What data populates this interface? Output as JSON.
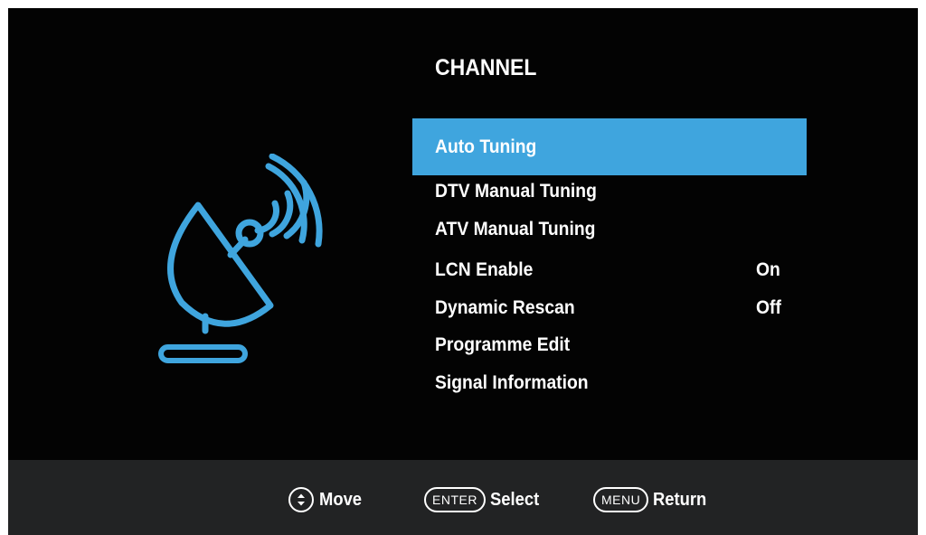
{
  "menu": {
    "title": "CHANNEL",
    "items": [
      {
        "label": "Auto Tuning",
        "value": "",
        "selected": true
      },
      {
        "label": "DTV Manual Tuning",
        "value": ""
      },
      {
        "label": "ATV Manual Tuning",
        "value": ""
      },
      {
        "label": "LCN Enable",
        "value": "On"
      },
      {
        "label": "Dynamic Rescan",
        "value": "Off"
      },
      {
        "label": "Programme Edit",
        "value": ""
      },
      {
        "label": "Signal Information",
        "value": ""
      }
    ]
  },
  "icon": {
    "name": "satellite-dish-icon",
    "color": "#3fa5de"
  },
  "footer": {
    "move_label": "Move",
    "move_icon": "up-down-arrows-icon",
    "enter_key": "ENTER",
    "select_label": "Select",
    "menu_key": "MENU",
    "return_label": "Return"
  },
  "colors": {
    "background": "#030303",
    "highlight": "#3fa5de",
    "footer_bg": "#222324",
    "text": "#ffffff"
  }
}
